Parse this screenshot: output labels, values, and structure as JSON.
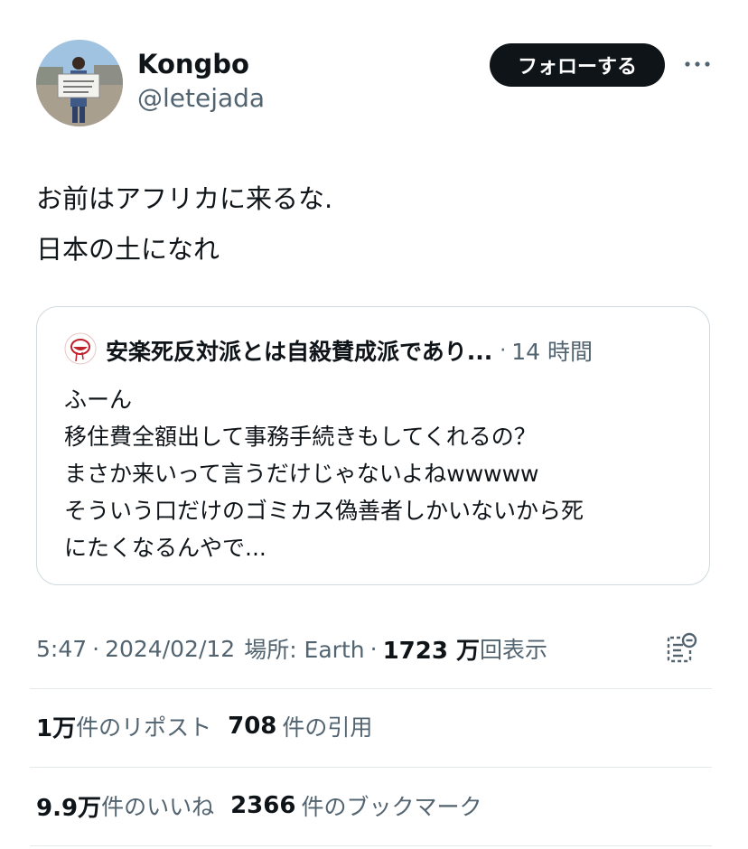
{
  "author": {
    "display_name": "Kongbo",
    "handle": "@letejada"
  },
  "follow_button": "フォローする",
  "tweet": {
    "lines": [
      "お前はアフリカに来るな.",
      "日本の土になれ"
    ]
  },
  "quote": {
    "name": "安楽死反対派とは自殺賛成派であり...",
    "dot": "·",
    "time": "14 時間",
    "lines": [
      "ふーん",
      "移住費全額出して事務手続きもしてくれるの？",
      "まさか来いって言うだけじゃないよねwwwww",
      "そういう口だけのゴミカス偽善者しかいないから死",
      "にたくなるんやで..."
    ]
  },
  "meta": {
    "time": "5:47",
    "dot": "·",
    "date": "2024/02/12",
    "location": "場所: Earth",
    "views_count": "1723 万",
    "views_label": "回表示"
  },
  "stats": {
    "reposts_count": "1万",
    "reposts_label": "件のリポスト",
    "quotes_count": "708",
    "quotes_label": "件の引用",
    "likes_count": "9.9万",
    "likes_label": "件のいいね",
    "bookmarks_count": "2366",
    "bookmarks_label": "件のブックマーク"
  },
  "icons": {
    "more": "more-dots-icon",
    "analytics": "analytics-icon"
  },
  "colors": {
    "text": "#0f1419",
    "secondary": "#536471",
    "border": "#cfd9de",
    "button": "#0f1419"
  }
}
